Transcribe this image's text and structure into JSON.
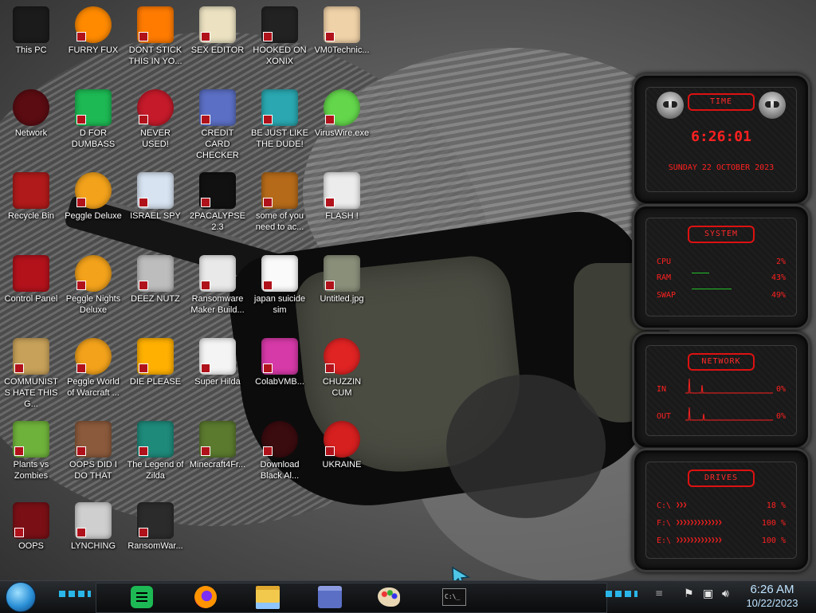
{
  "desktop": {
    "icons": [
      {
        "label": "This PC",
        "icon": "computer-icon"
      },
      {
        "label": "FURRY FUX",
        "icon": "firefox-icon"
      },
      {
        "label": "DONT STICK THIS IN YO...",
        "icon": "vlc-cone-icon"
      },
      {
        "label": "SEX EDITOR",
        "icon": "hxd-icon"
      },
      {
        "label": "HOOKED ON XONIX",
        "icon": "xonix-icon"
      },
      {
        "label": "VM0Technic...",
        "icon": "doctor-icon"
      },
      {
        "label": "Network",
        "icon": "network-orb-icon"
      },
      {
        "label": "D FOR DUMBASS",
        "icon": "spotify-green-icon"
      },
      {
        "label": "NEVER USED!",
        "icon": "devcpp-icon"
      },
      {
        "label": "CREDIT CARD CHECKER",
        "icon": "credit-card-icon"
      },
      {
        "label": "BE JUST LIKE THE DUDE!",
        "icon": "elf-icon"
      },
      {
        "label": "VirusWire.exe",
        "icon": "limewire-icon"
      },
      {
        "label": "Recycle Bin",
        "icon": "recycle-bin-icon"
      },
      {
        "label": "Peggle Deluxe",
        "icon": "peggle-icon"
      },
      {
        "label": "ISRAEL SPY",
        "icon": "spy-computer-icon"
      },
      {
        "label": "2PACALYPSE 2.3",
        "icon": "terminal-icon"
      },
      {
        "label": "some of you need to ac...",
        "icon": "scooby-icon"
      },
      {
        "label": "FLASH !",
        "icon": "flash-icon"
      },
      {
        "label": "Control Panel",
        "icon": "control-panel-icon"
      },
      {
        "label": "Peggle Nights Deluxe",
        "icon": "peggle-icon"
      },
      {
        "label": "DEEZ NUTZ",
        "icon": "windows-stack-icon"
      },
      {
        "label": "Ransomware Maker Build...",
        "icon": "window-app-icon"
      },
      {
        "label": "japan suicide sim",
        "icon": "file-icon"
      },
      {
        "label": "Untitled.jpg",
        "icon": "image-file-icon"
      },
      {
        "label": "COMMUNISTS HATE THIS G...",
        "icon": "money-bag-icon"
      },
      {
        "label": "Peggle World of Warcraft ...",
        "icon": "peggle-icon"
      },
      {
        "label": "DIE PLEASE",
        "icon": "adobe-de-icon"
      },
      {
        "label": "Super Hilda",
        "icon": "pixel-dog-icon"
      },
      {
        "label": "ColabVMB...",
        "icon": "colabvm-icon"
      },
      {
        "label": "CHUZZIN CUM",
        "icon": "chuzzle-icon"
      },
      {
        "label": "Plants vs Zombies",
        "icon": "pvz-icon"
      },
      {
        "label": "OOPS DID I DO THAT",
        "icon": "portrait-icon"
      },
      {
        "label": "The Legend of Zilda",
        "icon": "pixel-hero-icon"
      },
      {
        "label": "Minecraft4Fr...",
        "icon": "minecraft-icon"
      },
      {
        "label": "Download Black Al...",
        "icon": "black-orb-icon"
      },
      {
        "label": "UKRAINE",
        "icon": "radiation-icon"
      },
      {
        "label": "OOPS",
        "icon": "red-box-icon"
      },
      {
        "label": "LYNCHING",
        "icon": "gear-flag-icon"
      },
      {
        "label": "RansomWar...",
        "icon": "skull-icon"
      }
    ]
  },
  "gadgets": {
    "time": {
      "title": "TIME",
      "clock": "6:26:01",
      "date": "SUNDAY 22 OCTOBER 2023"
    },
    "system": {
      "title": "SYSTEM",
      "cpu_label": "CPU",
      "cpu_value": "2%",
      "ram_label": "RAM",
      "ram_value": "43%",
      "swap_label": "SWAP",
      "swap_value": "49%"
    },
    "network": {
      "title": "NETWORK",
      "in_label": "IN",
      "in_value": "0%",
      "out_label": "OUT",
      "out_value": "0%"
    },
    "drives": {
      "title": "DRIVES",
      "c_label": "C:\\",
      "c_value": "18 %",
      "f_label": "F:\\",
      "f_value": "100 %",
      "e_label": "E:\\",
      "e_value": "100 %"
    }
  },
  "taskbar": {
    "start_icon": "start-orb-icon",
    "pinned": [
      "spotify-green-icon",
      "firefox-icon",
      "file-explorer-icon",
      "credit-card-icon",
      "paint-palette-icon",
      "terminal-icon"
    ],
    "clock_time": "6:26 AM",
    "clock_date": "10/22/2023"
  },
  "colors": {
    "gadget_red": "#ff2020",
    "accent_cyan": "#2aa7d8"
  }
}
